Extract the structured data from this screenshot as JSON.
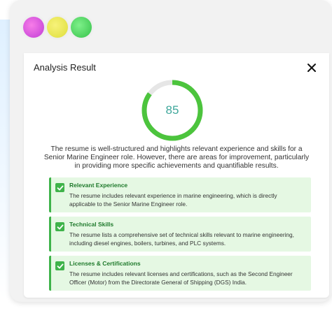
{
  "window": {
    "traffic_lights": [
      "purple",
      "yellow",
      "green"
    ]
  },
  "modal": {
    "title": "Analysis Result",
    "close_icon": "close-icon"
  },
  "score": {
    "value": "85",
    "fraction": 0.85,
    "ring_color": "#4cc43d",
    "track_color": "#e6e6e6"
  },
  "summary": "The resume is well-structured and highlights relevant experience and skills for a Senior Marine Engineer role. However, there are areas for improvement, particularly in providing more specific achievements and quantifiable results.",
  "items": [
    {
      "title": "Relevant Experience",
      "text": "The resume includes relevant experience in marine engineering, which is directly applicable to the Senior Marine Engineer role.",
      "icon": "check-icon"
    },
    {
      "title": "Technical Skills",
      "text": "The resume lists a comprehensive set of technical skills relevant to marine engineering, including diesel engines, boilers, turbines, and PLC systems.",
      "icon": "check-icon"
    },
    {
      "title": "Licenses & Certifications",
      "text": "The resume includes relevant licenses and certifications, such as the Second Engineer Officer (Motor) from the Directorate General of Shipping (DGS) India.",
      "icon": "check-icon"
    }
  ],
  "colors": {
    "accent_green": "#3fb34a",
    "card_bg": "#e5f8e3",
    "score_text": "#3fa79b"
  }
}
